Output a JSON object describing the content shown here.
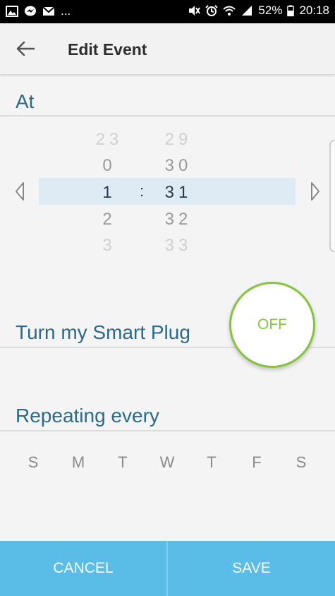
{
  "status_bar": {
    "left_extra": "...",
    "battery": "52%",
    "time": "20:18"
  },
  "app_bar": {
    "title": "Edit Event"
  },
  "at": {
    "label": "At"
  },
  "time_picker": {
    "hours": [
      "23",
      "0",
      "1",
      "2",
      "3"
    ],
    "minutes": [
      "29",
      "30",
      "31",
      "32",
      "33"
    ],
    "separator": ":",
    "selected_hour": "1",
    "selected_minute": "31"
  },
  "smart_plug": {
    "label": "Turn my Smart Plug",
    "toggle": "OFF",
    "accent_color": "#86c43f"
  },
  "repeat": {
    "label": "Repeating every",
    "days": [
      "S",
      "M",
      "T",
      "W",
      "T",
      "F",
      "S"
    ]
  },
  "actions": {
    "cancel": "CANCEL",
    "save": "SAVE",
    "bar_color": "#59bde8"
  },
  "icons": {
    "status_left": [
      "gallery-icon",
      "messenger-icon",
      "gmail-icon"
    ],
    "status_right": [
      "mute-icon",
      "alarm-icon",
      "wifi-icon",
      "signal-icon",
      "battery-icon"
    ],
    "nav": "back-arrow-icon",
    "picker_prev": "chevron-left-icon",
    "picker_next": "chevron-right-icon"
  }
}
